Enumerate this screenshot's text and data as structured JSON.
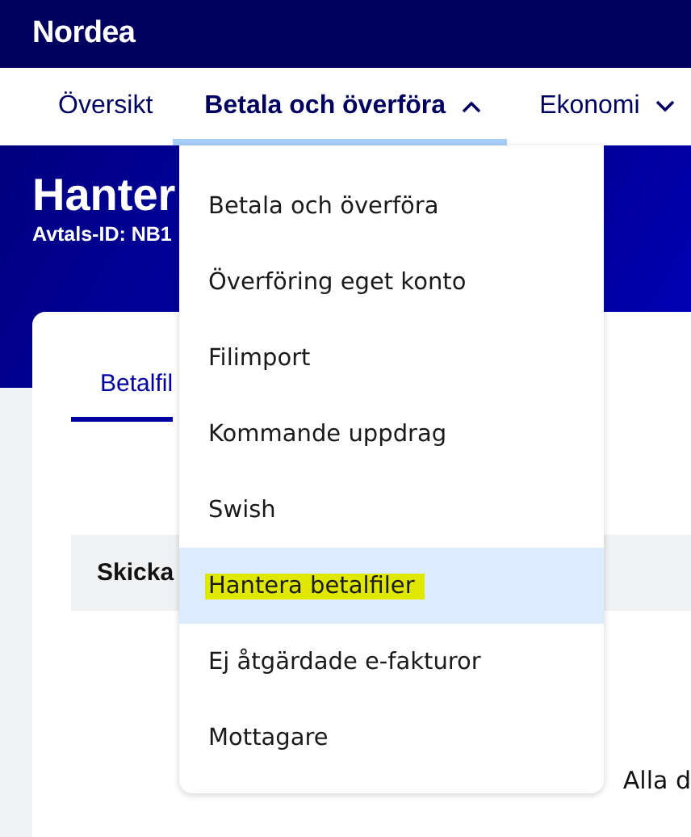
{
  "brand": {
    "logo": "Nordea"
  },
  "nav": [
    {
      "label": "Översikt",
      "selected": false,
      "kind": "link"
    },
    {
      "label": "Betala och överföra",
      "selected": true,
      "kind": "menu",
      "expanded": true
    },
    {
      "label": "Ekonomi",
      "selected": false,
      "kind": "menu",
      "expanded": false
    }
  ],
  "hero": {
    "title": "Hanter",
    "subtitle": "Avtals-ID: NB1"
  },
  "card": {
    "tabs": [
      {
        "label": "Betalfil",
        "selected": true
      }
    ],
    "table_header": "Skicka",
    "footer_text": "Alla d"
  },
  "dropdown": {
    "items": [
      {
        "label": "Betala och överföra",
        "selected": false,
        "highlighted": false
      },
      {
        "label": "Överföring eget konto",
        "selected": false,
        "highlighted": false
      },
      {
        "label": "Filimport",
        "selected": false,
        "highlighted": false
      },
      {
        "label": "Kommande uppdrag",
        "selected": false,
        "highlighted": false
      },
      {
        "label": "Swish",
        "selected": false,
        "highlighted": false
      },
      {
        "label": "Hantera betalfiler",
        "selected": true,
        "highlighted": true
      },
      {
        "label": "Ej åtgärdade e-fakturor",
        "selected": false,
        "highlighted": false
      },
      {
        "label": "Mottagare",
        "selected": false,
        "highlighted": false
      }
    ]
  }
}
